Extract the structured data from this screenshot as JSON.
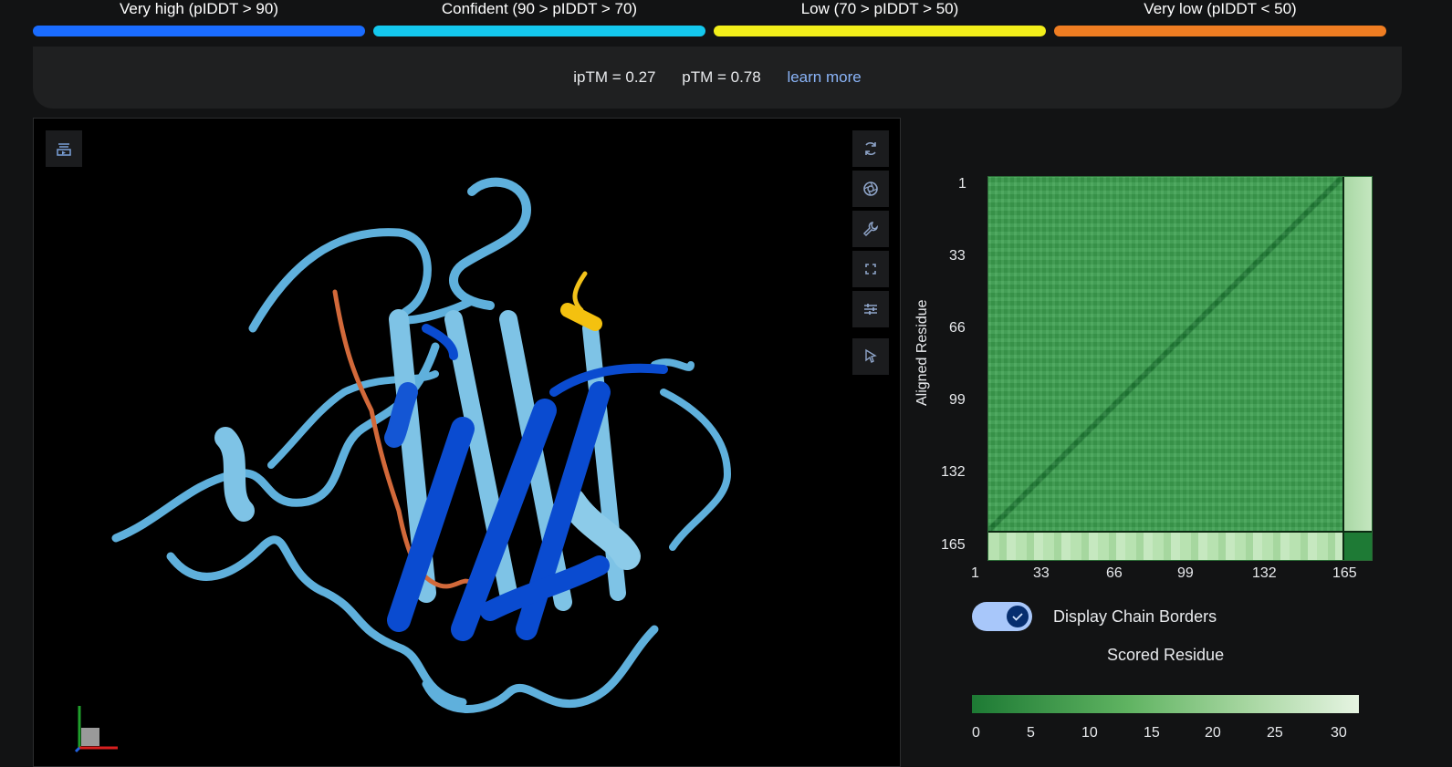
{
  "legend": [
    {
      "label": "Very high (pIDDT > 90)",
      "color": "#1a6cff"
    },
    {
      "label": "Confident (90 > pIDDT > 70)",
      "color": "#14c8ee"
    },
    {
      "label": "Low (70 > pIDDT > 50)",
      "color": "#f2ee1a"
    },
    {
      "label": "Very low (pIDDT < 50)",
      "color": "#ef7d22"
    }
  ],
  "summary": {
    "iptm": "ipTM = 0.27",
    "ptm": "pTM = 0.78",
    "learn_more": "learn more"
  },
  "viewer": {
    "top_left_button": "layers-icon",
    "toolbar": [
      "rotate-icon",
      "camera-icon",
      "wrench-icon",
      "fullscreen-icon",
      "sliders-icon",
      "cursor-icon"
    ]
  },
  "pae": {
    "y_axis_title": "Aligned Residue",
    "y_ticks": [
      "1",
      "33",
      "66",
      "99",
      "132",
      "165"
    ],
    "x_ticks": [
      "1",
      "33",
      "66",
      "99",
      "132",
      "165"
    ],
    "toggle_label": "Display Chain Borders",
    "toggle_on": true,
    "x_axis_title": "Scored Residue",
    "colorbar_ticks": [
      "0",
      "5",
      "10",
      "15",
      "20",
      "25",
      "30"
    ]
  }
}
